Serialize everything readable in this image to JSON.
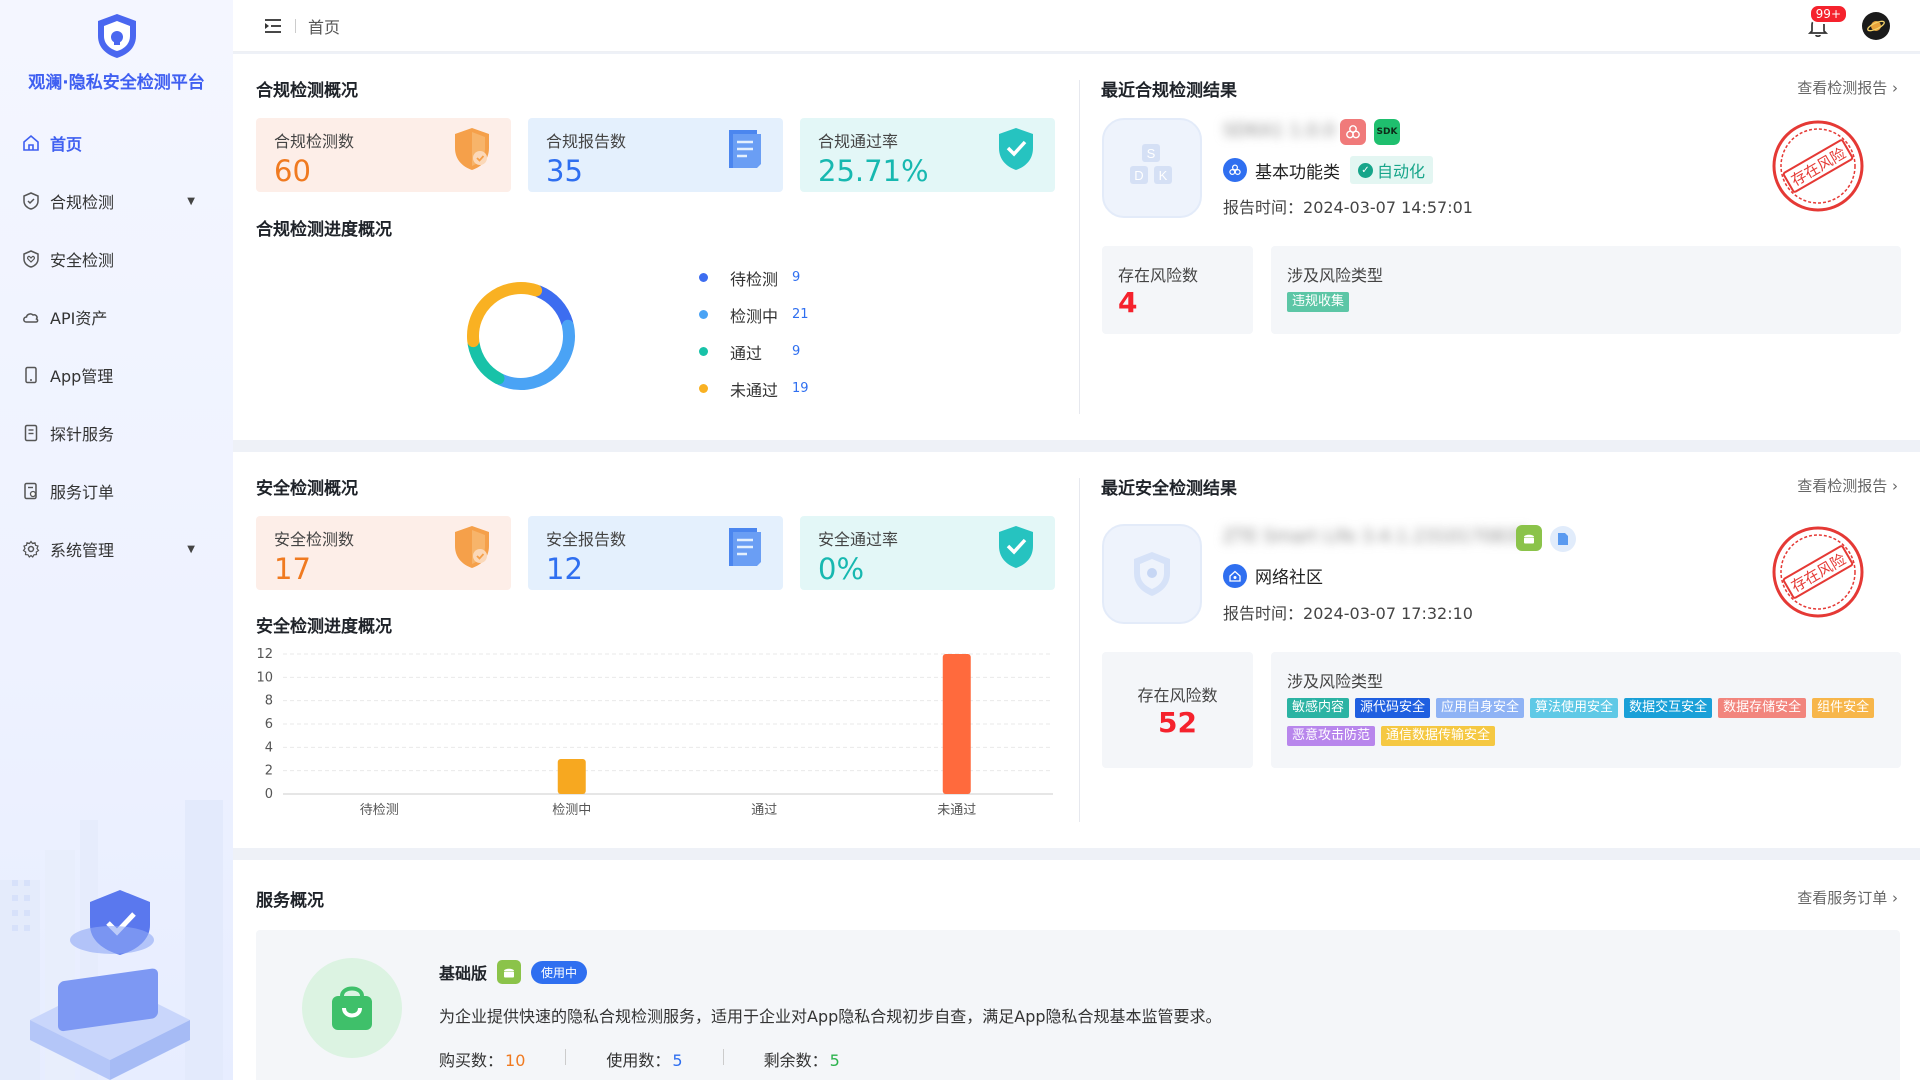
{
  "app": {
    "title": "观澜·隐私安全检测平台"
  },
  "sidebar": {
    "items": [
      {
        "label": "首页",
        "icon": "home-icon",
        "active": true,
        "expandable": false
      },
      {
        "label": "合规检测",
        "icon": "shield-check-icon",
        "active": false,
        "expandable": true
      },
      {
        "label": "安全检测",
        "icon": "shield-heart-icon",
        "active": false,
        "expandable": false
      },
      {
        "label": "API资产",
        "icon": "cloud-icon",
        "active": false,
        "expandable": false
      },
      {
        "label": "App管理",
        "icon": "phone-icon",
        "active": false,
        "expandable": false
      },
      {
        "label": "探针服务",
        "icon": "probe-icon",
        "active": false,
        "expandable": false
      },
      {
        "label": "服务订单",
        "icon": "order-icon",
        "active": false,
        "expandable": false
      },
      {
        "label": "系统管理",
        "icon": "gear-icon",
        "active": false,
        "expandable": true
      }
    ]
  },
  "header": {
    "breadcrumb": "首页",
    "notification_badge": "99+"
  },
  "compliance": {
    "title": "合规检测概况",
    "stats": [
      {
        "label": "合规检测数",
        "value": "60",
        "color": "#f07a20"
      },
      {
        "label": "合规报告数",
        "value": "35",
        "color": "#2f6ff0"
      },
      {
        "label": "合规通过率",
        "value": "25.71%",
        "color": "#17b8b0"
      }
    ],
    "progress_title": "合规检测进度概况",
    "legend": [
      {
        "name": "待检测",
        "value": "9",
        "color": "#3d6df0"
      },
      {
        "name": "检测中",
        "value": "21",
        "color": "#4aa3f5"
      },
      {
        "name": "通过",
        "value": "9",
        "color": "#18c2a8"
      },
      {
        "name": "未通过",
        "value": "19",
        "color": "#f9b122"
      }
    ],
    "recent": {
      "title": "最近合规检测结果",
      "more": "查看检测报告",
      "app_name": "SDKA1 1.0.0",
      "sdk_badge": "SDK",
      "category": "基本功能类",
      "auto_tag": "自动化",
      "report_time_label": "报告时间：",
      "report_time": "2024-03-07 14:57:01",
      "stamp": "存在风险",
      "risk_count_label": "存在风险数",
      "risk_count": "4",
      "risk_types_label": "涉及风险类型",
      "risk_types": [
        {
          "label": "违规收集",
          "color": "#5cc6a6"
        }
      ]
    }
  },
  "security": {
    "title": "安全检测概况",
    "stats": [
      {
        "label": "安全检测数",
        "value": "17",
        "color": "#f07a20"
      },
      {
        "label": "安全报告数",
        "value": "12",
        "color": "#2f6ff0"
      },
      {
        "label": "安全通过率",
        "value": "0%",
        "color": "#17b8b0"
      }
    ],
    "progress_title": "安全检测进度概况",
    "recent": {
      "title": "最近安全检测结果",
      "more": "查看检测报告",
      "app_name": "ZTE Smart Life 3.4.1.2310170835",
      "category": "网络社区",
      "report_time_label": "报告时间：",
      "report_time": "2024-03-07 17:32:10",
      "stamp": "存在风险",
      "risk_count_label": "存在风险数",
      "risk_count": "52",
      "risk_types_label": "涉及风险类型",
      "risk_types": [
        {
          "label": "敏感内容",
          "color": "#2bb3a3"
        },
        {
          "label": "源代码安全",
          "color": "#1f5fe0"
        },
        {
          "label": "应用自身安全",
          "color": "#8fb3f5"
        },
        {
          "label": "算法使用安全",
          "color": "#5fc9e6"
        },
        {
          "label": "数据交互安全",
          "color": "#1aa0d8"
        },
        {
          "label": "数据存储安全",
          "color": "#f2857d"
        },
        {
          "label": "组件安全",
          "color": "#f7b64a"
        },
        {
          "label": "恶意攻击防范",
          "color": "#b886ec"
        },
        {
          "label": "通信数据传输安全",
          "color": "#f5c842"
        }
      ]
    }
  },
  "chart_data": {
    "type": "bar",
    "categories": [
      "待检测",
      "检测中",
      "通过",
      "未通过"
    ],
    "values": [
      0,
      3,
      0,
      12
    ],
    "colors": [
      "#f7a820",
      "#f7a820",
      "#f7a820",
      "#ff6a3d"
    ],
    "ylim": [
      0,
      12
    ],
    "yticks": [
      "12",
      "10",
      "8",
      "6",
      "4",
      "2",
      "0"
    ],
    "grid": true
  },
  "service": {
    "title": "服务概况",
    "more": "查看服务订单",
    "plan_name": "基础版",
    "status": "使用中",
    "description": "为企业提供快速的隐私合规检测服务，适用于企业对App隐私合规初步自查，满足App隐私合规基本监管要求。",
    "bought_label": "购买数：",
    "bought": "10",
    "used_label": "使用数：",
    "used": "5",
    "remaining_label": "剩余数：",
    "remaining": "5"
  }
}
